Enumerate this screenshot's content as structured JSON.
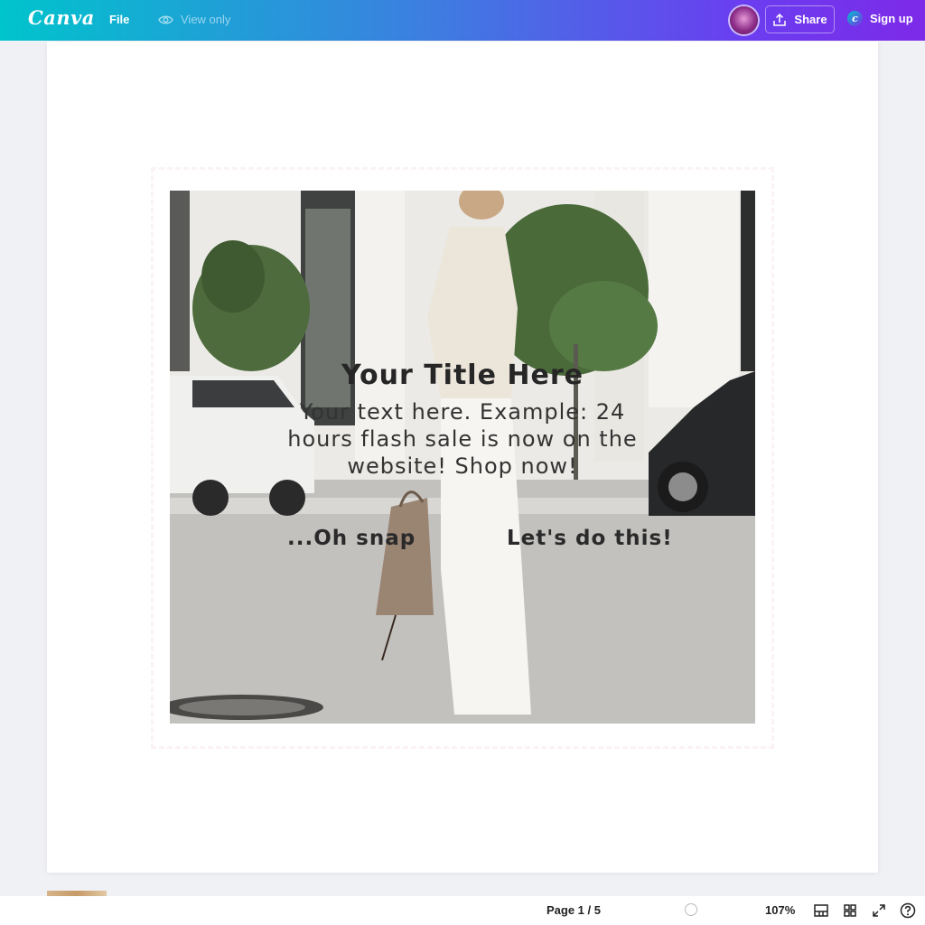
{
  "topbar": {
    "logo": "Canva",
    "file_label": "File",
    "view_only_label": "View only",
    "share_label": "Share",
    "signup_label": "Sign up"
  },
  "design": {
    "title": "Your Title Here",
    "body": "Your text here. Example: 24 hours flash sale is now on the website! Shop now!",
    "button_left": "...Oh snap",
    "button_right": "Let's do this!"
  },
  "bottombar": {
    "page_info": "Page 1 / 5",
    "zoom": "107%"
  },
  "colors": {
    "gradient_start": "#00c4cc",
    "gradient_end": "#7d2ae8",
    "page_bg": "#ffffff",
    "canvas_bg": "#f0f1f4"
  },
  "icons": [
    "eye-icon",
    "share-upload-icon",
    "notes-icon",
    "grid-view-icon",
    "fullscreen-icon",
    "help-icon"
  ]
}
